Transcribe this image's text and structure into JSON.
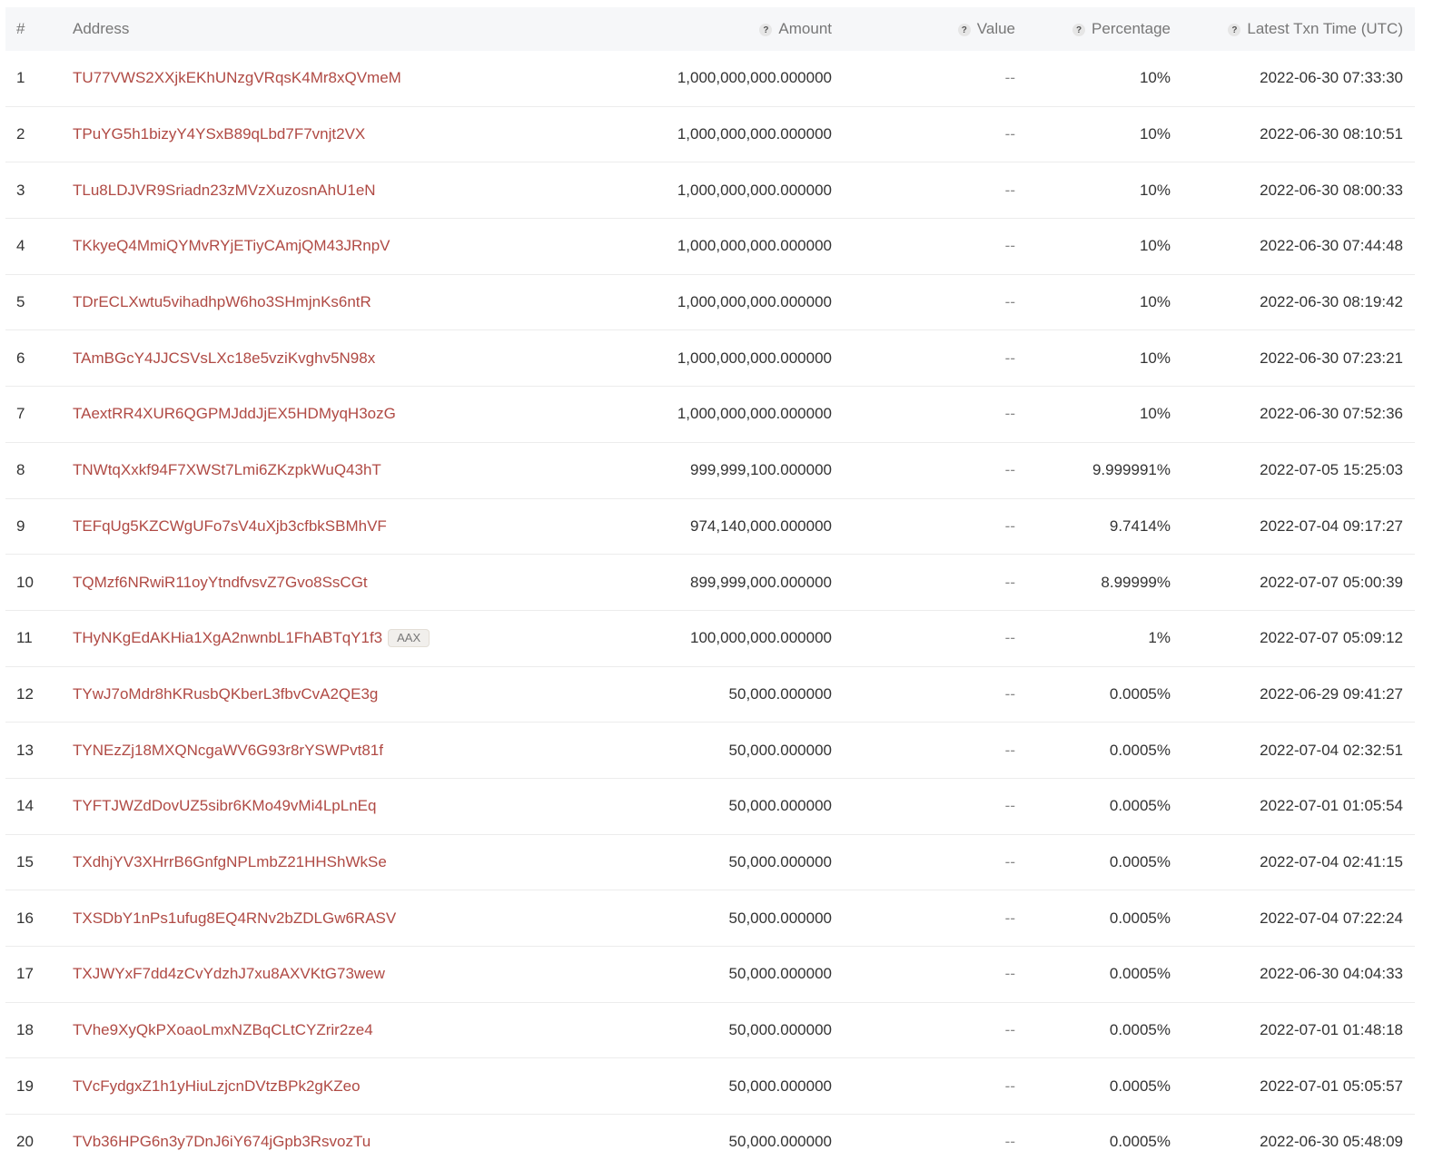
{
  "header": {
    "idx": "#",
    "address": "Address",
    "amount": "Amount",
    "value": "Value",
    "percentage": "Percentage",
    "time": "Latest Txn Time (UTC)",
    "help_glyph": "?"
  },
  "rows": [
    {
      "idx": "1",
      "address": "TU77VWS2XXjkEKhUNzgVRqsK4Mr8xQVmeM",
      "tag": "",
      "amount": "1,000,000,000.000000",
      "value": "--",
      "percentage": "10%",
      "time": "2022-06-30 07:33:30"
    },
    {
      "idx": "2",
      "address": "TPuYG5h1bizyY4YSxB89qLbd7F7vnjt2VX",
      "tag": "",
      "amount": "1,000,000,000.000000",
      "value": "--",
      "percentage": "10%",
      "time": "2022-06-30 08:10:51"
    },
    {
      "idx": "3",
      "address": "TLu8LDJVR9Sriadn23zMVzXuzosnAhU1eN",
      "tag": "",
      "amount": "1,000,000,000.000000",
      "value": "--",
      "percentage": "10%",
      "time": "2022-06-30 08:00:33"
    },
    {
      "idx": "4",
      "address": "TKkyeQ4MmiQYMvRYjETiyCAmjQM43JRnpV",
      "tag": "",
      "amount": "1,000,000,000.000000",
      "value": "--",
      "percentage": "10%",
      "time": "2022-06-30 07:44:48"
    },
    {
      "idx": "5",
      "address": "TDrECLXwtu5vihadhpW6ho3SHmjnKs6ntR",
      "tag": "",
      "amount": "1,000,000,000.000000",
      "value": "--",
      "percentage": "10%",
      "time": "2022-06-30 08:19:42"
    },
    {
      "idx": "6",
      "address": "TAmBGcY4JJCSVsLXc18e5vziKvghv5N98x",
      "tag": "",
      "amount": "1,000,000,000.000000",
      "value": "--",
      "percentage": "10%",
      "time": "2022-06-30 07:23:21"
    },
    {
      "idx": "7",
      "address": "TAextRR4XUR6QGPMJddJjEX5HDMyqH3ozG",
      "tag": "",
      "amount": "1,000,000,000.000000",
      "value": "--",
      "percentage": "10%",
      "time": "2022-06-30 07:52:36"
    },
    {
      "idx": "8",
      "address": "TNWtqXxkf94F7XWSt7Lmi6ZKzpkWuQ43hT",
      "tag": "",
      "amount": "999,999,100.000000",
      "value": "--",
      "percentage": "9.999991%",
      "time": "2022-07-05 15:25:03"
    },
    {
      "idx": "9",
      "address": "TEFqUg5KZCWgUFo7sV4uXjb3cfbkSBMhVF",
      "tag": "",
      "amount": "974,140,000.000000",
      "value": "--",
      "percentage": "9.7414%",
      "time": "2022-07-04 09:17:27"
    },
    {
      "idx": "10",
      "address": "TQMzf6NRwiR11oyYtndfvsvZ7Gvo8SsCGt",
      "tag": "",
      "amount": "899,999,000.000000",
      "value": "--",
      "percentage": "8.99999%",
      "time": "2022-07-07 05:00:39"
    },
    {
      "idx": "11",
      "address": "THyNKgEdAKHia1XgA2nwnbL1FhABTqY1f3",
      "tag": "AAX",
      "amount": "100,000,000.000000",
      "value": "--",
      "percentage": "1%",
      "time": "2022-07-07 05:09:12"
    },
    {
      "idx": "12",
      "address": "TYwJ7oMdr8hKRusbQKberL3fbvCvA2QE3g",
      "tag": "",
      "amount": "50,000.000000",
      "value": "--",
      "percentage": "0.0005%",
      "time": "2022-06-29 09:41:27"
    },
    {
      "idx": "13",
      "address": "TYNEzZj18MXQNcgaWV6G93r8rYSWPvt81f",
      "tag": "",
      "amount": "50,000.000000",
      "value": "--",
      "percentage": "0.0005%",
      "time": "2022-07-04 02:32:51"
    },
    {
      "idx": "14",
      "address": "TYFTJWZdDovUZ5sibr6KMo49vMi4LpLnEq",
      "tag": "",
      "amount": "50,000.000000",
      "value": "--",
      "percentage": "0.0005%",
      "time": "2022-07-01 01:05:54"
    },
    {
      "idx": "15",
      "address": "TXdhjYV3XHrrB6GnfgNPLmbZ21HHShWkSe",
      "tag": "",
      "amount": "50,000.000000",
      "value": "--",
      "percentage": "0.0005%",
      "time": "2022-07-04 02:41:15"
    },
    {
      "idx": "16",
      "address": "TXSDbY1nPs1ufug8EQ4RNv2bZDLGw6RASV",
      "tag": "",
      "amount": "50,000.000000",
      "value": "--",
      "percentage": "0.0005%",
      "time": "2022-07-04 07:22:24"
    },
    {
      "idx": "17",
      "address": "TXJWYxF7dd4zCvYdzhJ7xu8AXVKtG73wew",
      "tag": "",
      "amount": "50,000.000000",
      "value": "--",
      "percentage": "0.0005%",
      "time": "2022-06-30 04:04:33"
    },
    {
      "idx": "18",
      "address": "TVhe9XyQkPXoaoLmxNZBqCLtCYZrir2ze4",
      "tag": "",
      "amount": "50,000.000000",
      "value": "--",
      "percentage": "0.0005%",
      "time": "2022-07-01 01:48:18"
    },
    {
      "idx": "19",
      "address": "TVcFydgxZ1h1yHiuLzjcnDVtzBPk2gKZeo",
      "tag": "",
      "amount": "50,000.000000",
      "value": "--",
      "percentage": "0.0005%",
      "time": "2022-07-01 05:05:57"
    },
    {
      "idx": "20",
      "address": "TVb36HPG6n3y7DnJ6iY674jGpb3RsvozTu",
      "tag": "",
      "amount": "50,000.000000",
      "value": "--",
      "percentage": "0.0005%",
      "time": "2022-06-30 05:48:09"
    }
  ]
}
